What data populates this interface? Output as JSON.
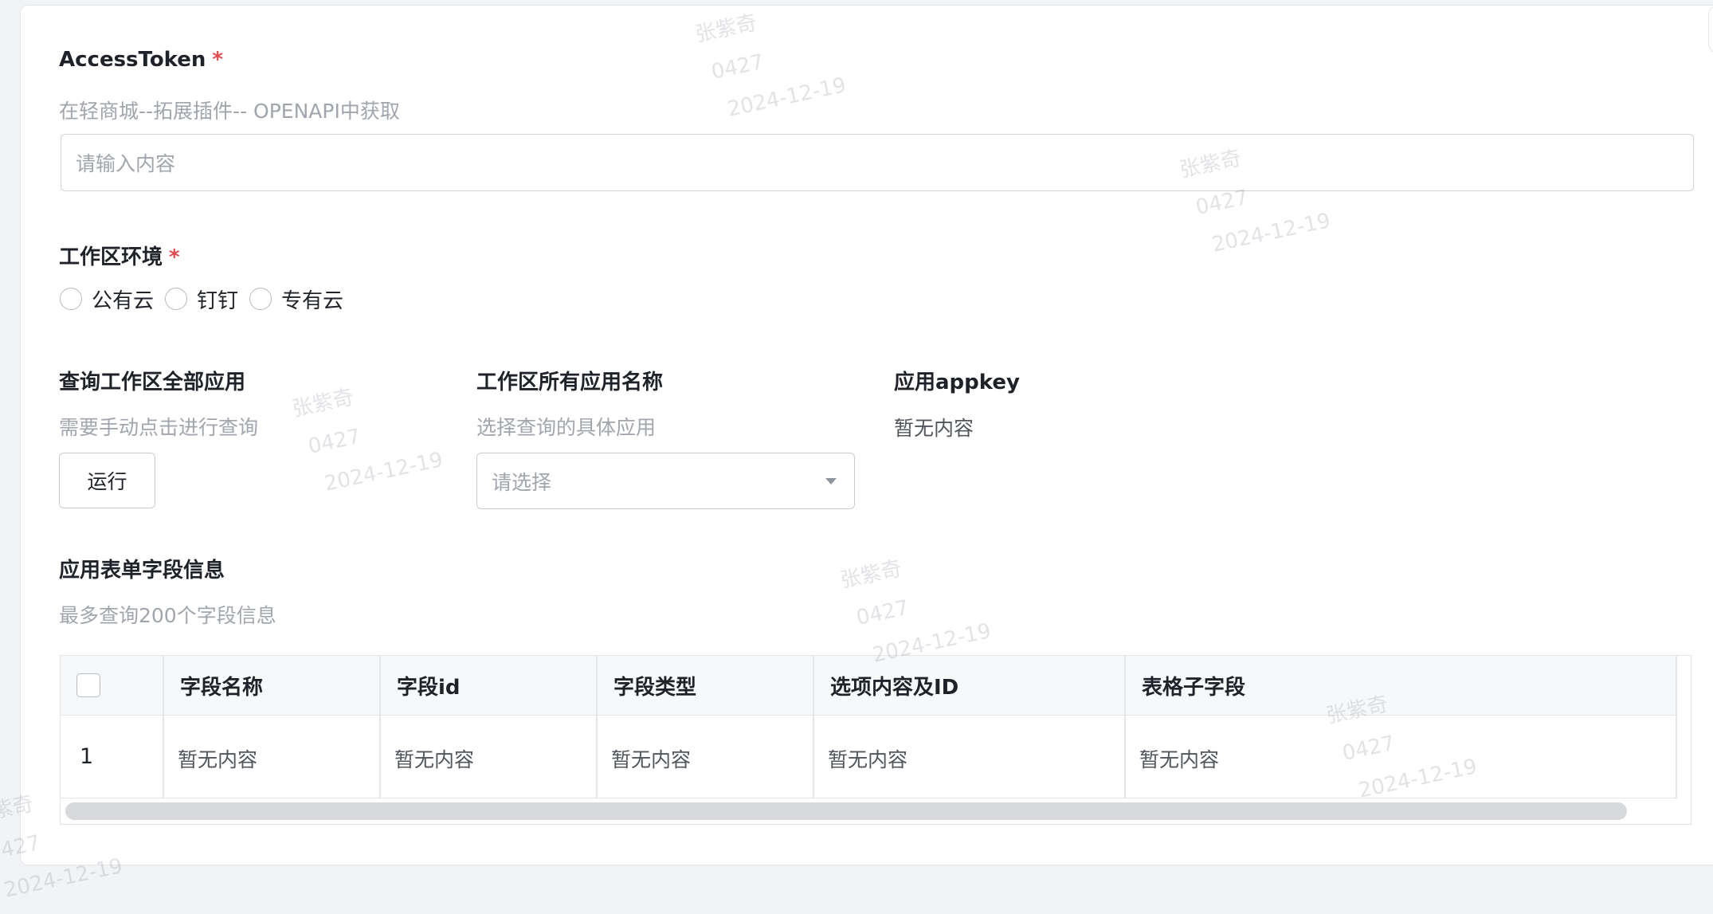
{
  "access_token": {
    "label": "AccessToken",
    "required_mark": "*",
    "hint": "在轻商城--拓展插件-- OPENAPI中获取",
    "input_placeholder": "请输入内容",
    "input_value": ""
  },
  "workspace_env": {
    "label": "工作区环境",
    "required_mark": "*",
    "options": [
      {
        "label": "公有云",
        "selected": false
      },
      {
        "label": "钉钉",
        "selected": false
      },
      {
        "label": "专有云",
        "selected": false
      }
    ]
  },
  "query_apps": {
    "label": "查询工作区全部应用",
    "hint": "需要手动点击进行查询",
    "button_label": "运行"
  },
  "app_names": {
    "label": "工作区所有应用名称",
    "hint": "选择查询的具体应用",
    "select_placeholder": "请选择"
  },
  "app_key": {
    "label": "应用appkey",
    "value": "暂无内容"
  },
  "form_fields": {
    "label": "应用表单字段信息",
    "hint": "最多查询200个字段信息",
    "columns": [
      "字段名称",
      "字段id",
      "字段类型",
      "选项内容及ID",
      "表格子字段"
    ],
    "rows": [
      {
        "index": "1",
        "cells": [
          "暂无内容",
          "暂无内容",
          "暂无内容",
          "暂无内容",
          "暂无内容"
        ]
      }
    ]
  },
  "watermark": {
    "name": "张紫奇",
    "code": "0427",
    "date": "2024-12-19"
  },
  "colors": {
    "required": "#e5484d",
    "hint": "#a1a5ad",
    "border": "#c7cbd1",
    "table_header_bg": "#f7f8fa",
    "scrollbar": "#d7d9dc"
  }
}
